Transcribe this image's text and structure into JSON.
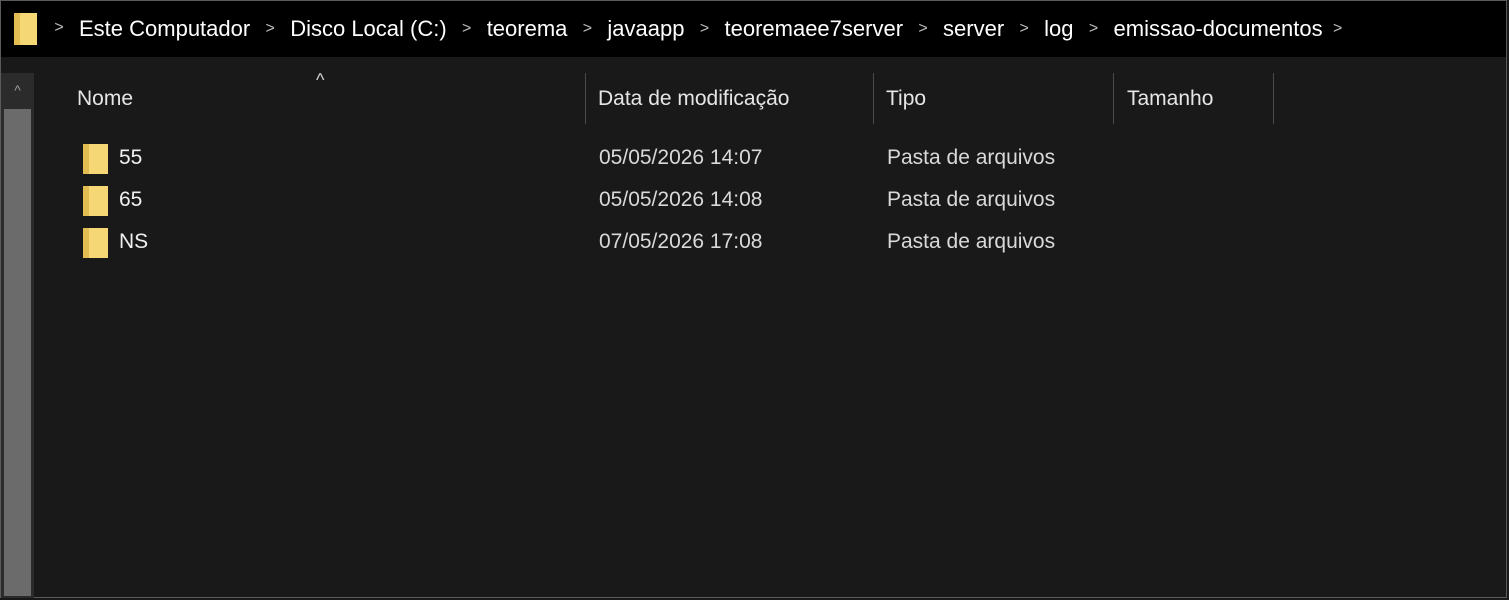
{
  "address_bar": {
    "breadcrumbs": [
      "Este Computador",
      "Disco Local (C:)",
      "teorema",
      "javaapp",
      "teoremaee7server",
      "server",
      "log",
      "emissao-documentos"
    ],
    "separator": ">"
  },
  "columns": {
    "name": "Nome",
    "date": "Data de modificação",
    "type": "Tipo",
    "size": "Tamanho",
    "sort_indicator": "^"
  },
  "files": [
    {
      "name": "55",
      "date": "05/05/2026 14:07",
      "type": "Pasta de arquivos",
      "size": ""
    },
    {
      "name": "65",
      "date": "05/05/2026 14:08",
      "type": "Pasta de arquivos",
      "size": ""
    },
    {
      "name": "NS",
      "date": "07/05/2026 17:08",
      "type": "Pasta de arquivos",
      "size": ""
    }
  ],
  "scrollbar": {
    "up_arrow": "^"
  },
  "colors": {
    "background": "#191919",
    "address_bar": "#000000",
    "folder": "#f6d776",
    "folder_shade": "#e2bd52"
  },
  "icons": [
    "folder-icon",
    "chevron-right-icon",
    "chevron-up-icon"
  ]
}
